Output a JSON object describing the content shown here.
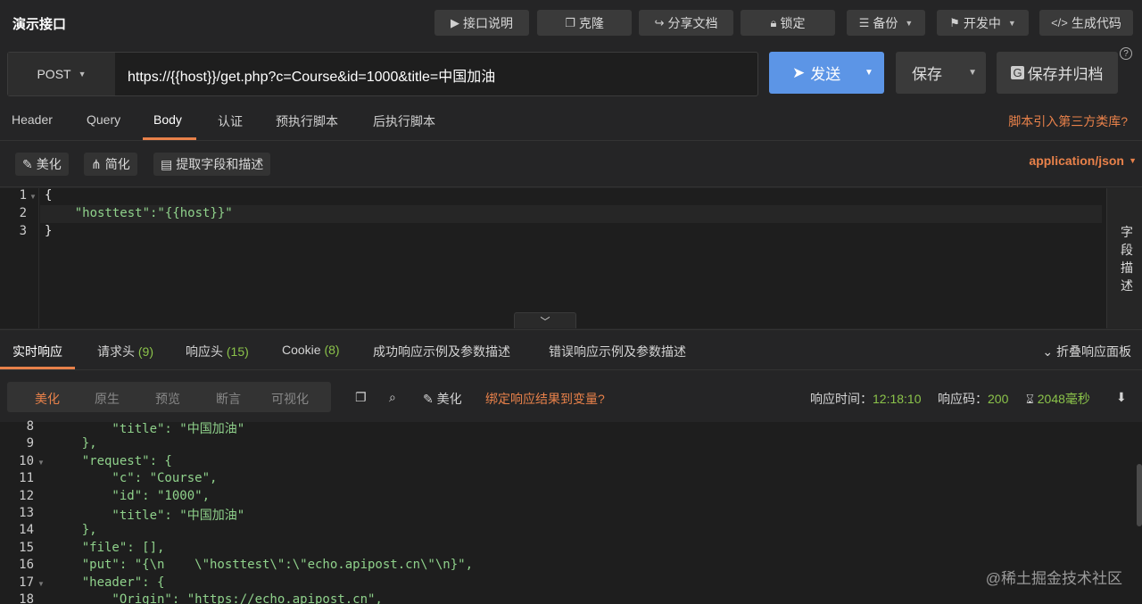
{
  "app": {
    "title": "演示接口"
  },
  "toolbar": {
    "doc_label": "接口说明",
    "clone_label": "克隆",
    "share_label": "分享文档",
    "lock_label": "锁定",
    "backup_label": "备份",
    "status_label": "开发中",
    "codegen_label": "生成代码"
  },
  "request": {
    "method": "POST",
    "url": "https://{{host}}/get.php?c=Course&id=1000&title=中国加油",
    "send_label": "发送",
    "save_label": "保存",
    "archive_label": "保存并归档",
    "help": "?"
  },
  "req_tabs": [
    "Header",
    "Query",
    "Body",
    "认证",
    "预执行脚本",
    "后执行脚本"
  ],
  "third_party_link": "脚本引入第三方类库?",
  "body_tools": {
    "beautify": "美化",
    "simplify": "简化",
    "extract": "提取字段和描述",
    "content_type": "application/json"
  },
  "editor": {
    "line_numbers": [
      "1",
      "2",
      "3"
    ],
    "lines": [
      "{",
      "    \"hosttest\":\"{{host}}\"",
      "}"
    ]
  },
  "side_desc": [
    "字",
    "段",
    "描",
    "述"
  ],
  "resp_tabs": [
    {
      "label": "实时响应",
      "count": ""
    },
    {
      "label": "请求头",
      "count": "(9)"
    },
    {
      "label": "响应头",
      "count": "(15)"
    },
    {
      "label": "Cookie",
      "count": "(8)"
    },
    {
      "label": "成功响应示例及参数描述",
      "count": ""
    },
    {
      "label": "错误响应示例及参数描述",
      "count": ""
    }
  ],
  "fold_panel_label": "折叠响应面板",
  "view_modes": [
    "美化",
    "原生",
    "预览",
    "断言",
    "可视化"
  ],
  "resp_tools": {
    "beautify": "美化",
    "bind_var": "绑定响应结果到变量?"
  },
  "resp_meta": {
    "time_label": "响应时间：",
    "time_value": "12:18:10",
    "code_label": "响应码：",
    "code_value": "200",
    "duration": "2048毫秒"
  },
  "response": {
    "line_numbers": [
      "8",
      "9",
      "10",
      "11",
      "12",
      "13",
      "14",
      "15",
      "16",
      "17",
      "18"
    ],
    "lines": [
      "        \"title\": \"中国加油\"",
      "    },",
      "    \"request\": {",
      "        \"c\": \"Course\",",
      "        \"id\": \"1000\",",
      "        \"title\": \"中国加油\"",
      "    },",
      "    \"file\": [],",
      "    \"put\": \"{\\n    \\\"hosttest\\\":\\\"echo.apipost.cn\\\"\\n}\",",
      "    \"header\": {",
      "        \"Origin\": \"https://echo.apipost.cn\","
    ]
  },
  "watermark": "@稀土掘金技术社区",
  "colors": {
    "accent": "#e8814a",
    "send": "#5c95e6",
    "count": "#8bc34a"
  }
}
